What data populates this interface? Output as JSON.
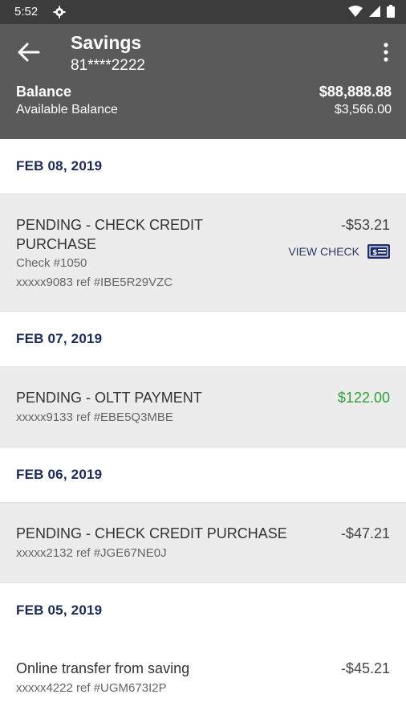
{
  "status_bar": {
    "time": "5:52"
  },
  "header": {
    "title": "Savings",
    "account_number": "81****2222",
    "balance_label": "Balance",
    "balance_value": "$88,888.88",
    "available_label": "Available Balance",
    "available_value": "$3,566.00"
  },
  "transactions": {
    "d1": {
      "date": "FEB 08, 2019"
    },
    "t1": {
      "desc_line1": "PENDING - CHECK CREDIT",
      "desc_line2": "PURCHASE",
      "check_no": "Check #1050",
      "ref": "xxxxx9083 ref #IBE5R29VZC",
      "amount": "-$53.21",
      "view_check": "VIEW CHECK"
    },
    "d2": {
      "date": "FEB 07, 2019"
    },
    "t2": {
      "desc": "PENDING - OLTT PAYMENT",
      "ref": "xxxxx9133 ref #EBE5Q3MBE",
      "amount": "$122.00"
    },
    "d3": {
      "date": "FEB 06, 2019"
    },
    "t3": {
      "desc": "PENDING - CHECK CREDIT PURCHASE",
      "ref": "xxxxx2132 ref #JGE67NE0J",
      "amount": "-$47.21"
    },
    "d4": {
      "date": "FEB 05, 2019"
    },
    "t4": {
      "desc": "Online transfer from saving",
      "ref": "xxxxx4222 ref #UGM673I2P",
      "amount": "-$45.21"
    }
  },
  "colors": {
    "status_bar": "#3c3c3c",
    "app_bar": "#5a5a5a",
    "date_text": "#1b2a57",
    "positive_amount": "#2e9e3b",
    "row_bg": "#ececec"
  },
  "icons": [
    "settings-gear-icon",
    "wifi-icon",
    "signal-icon",
    "battery-icon",
    "back-arrow-icon",
    "more-vert-icon",
    "check-image-icon"
  ]
}
